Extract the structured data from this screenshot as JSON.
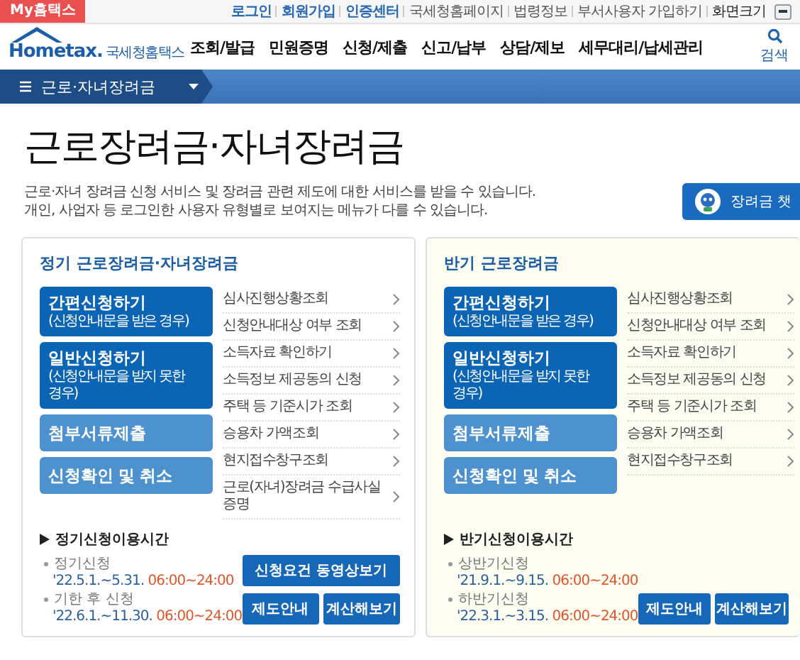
{
  "topbar": {
    "my_tab": "My홈택스",
    "links": [
      {
        "label": "로그인",
        "kind": "strong"
      },
      {
        "label": "회원가입",
        "kind": "strong"
      },
      {
        "label": "인증센터",
        "kind": "strong"
      },
      {
        "label": "국세청홈페이지",
        "kind": "plain"
      },
      {
        "label": "법령정보",
        "kind": "plain"
      },
      {
        "label": "부서사용자 가입하기",
        "kind": "plain"
      },
      {
        "label": "화면크기",
        "kind": "dark"
      }
    ]
  },
  "header": {
    "logo": {
      "wordmark": "Hometax.",
      "name": "국세청홈택스"
    },
    "menu": [
      "조회/발급",
      "민원증명",
      "신청/제출",
      "신고/납부",
      "상담/제보",
      "세무대리/납세관리"
    ],
    "search": "검색"
  },
  "breadcrumb": {
    "label": "근로·자녀장려금"
  },
  "page": {
    "title": "근로장려금·자녀장려금",
    "description": [
      "근로·자녀 장려금 신청 서비스 및 장려금 관련 제도에 대한 서비스를 받을 수 있습니다.",
      "개인, 사업자 등 로그인한 사용자 유형별로 보여지는 메뉴가 다를 수 있습니다."
    ],
    "chatbot": "장려금 챗"
  },
  "panels": [
    {
      "title": "정기 근로장려금·자녀장려금",
      "kind": "regular",
      "actions": [
        {
          "label": "간편신청하기",
          "sub": "(신청안내문을 받은 경우)",
          "kind": "primary"
        },
        {
          "label": "일반신청하기",
          "sub": "(신청안내문을 받지 못한 경우)",
          "kind": "primary"
        },
        {
          "label": "첨부서류제출",
          "kind": "secondary"
        },
        {
          "label": "신청확인 및 취소",
          "kind": "secondary"
        }
      ],
      "links": [
        "심사진행상황조회",
        "신청안내대상 여부 조회",
        "소득자료 확인하기",
        "소득정보 제공동의 신청",
        "주택 등 기준시가 조회",
        "승용차 가액조회",
        "현지접수창구조회",
        "근로(자녀)장려금 수급사실 증명"
      ],
      "schedule": {
        "heading": "정기신청이용시간",
        "items": [
          {
            "label": "정기신청",
            "dates": "'22.5.1.~5.31.",
            "hours": "06:00~24:00"
          },
          {
            "label": "기한 후 신청",
            "dates": "'22.6.1.~11.30.",
            "hours": "06:00~24:00"
          }
        ]
      },
      "buttons": [
        {
          "label": "신청요건 동영상보기",
          "kind": "wide"
        },
        {
          "label": "제도안내",
          "kind": "half"
        },
        {
          "label": "계산해보기",
          "kind": "half"
        }
      ]
    },
    {
      "title": "반기 근로장려금",
      "kind": "semiannual",
      "actions": [
        {
          "label": "간편신청하기",
          "sub": "(신청안내문을 받은 경우)",
          "kind": "primary"
        },
        {
          "label": "일반신청하기",
          "sub": "(신청안내문을 받지 못한 경우)",
          "kind": "primary"
        },
        {
          "label": "첨부서류제출",
          "kind": "secondary"
        },
        {
          "label": "신청확인 및 취소",
          "kind": "secondary"
        }
      ],
      "links": [
        "심사진행상황조회",
        "신청안내대상 여부 조회",
        "소득자료 확인하기",
        "소득정보 제공동의 신청",
        "주택 등 기준시가 조회",
        "승용차 가액조회",
        "현지접수창구조회"
      ],
      "schedule": {
        "heading": "반기신청이용시간",
        "items": [
          {
            "label": "상반기신청",
            "dates": "'21.9.1.~9.15.",
            "hours": "06:00~24:00"
          },
          {
            "label": "하반기신청",
            "dates": "'22.3.1.~3.15.",
            "hours": "06:00~24:00"
          }
        ]
      },
      "buttons": [
        {
          "label": "제도안내",
          "kind": "half"
        },
        {
          "label": "계산해보기",
          "kind": "half"
        }
      ]
    }
  ]
}
